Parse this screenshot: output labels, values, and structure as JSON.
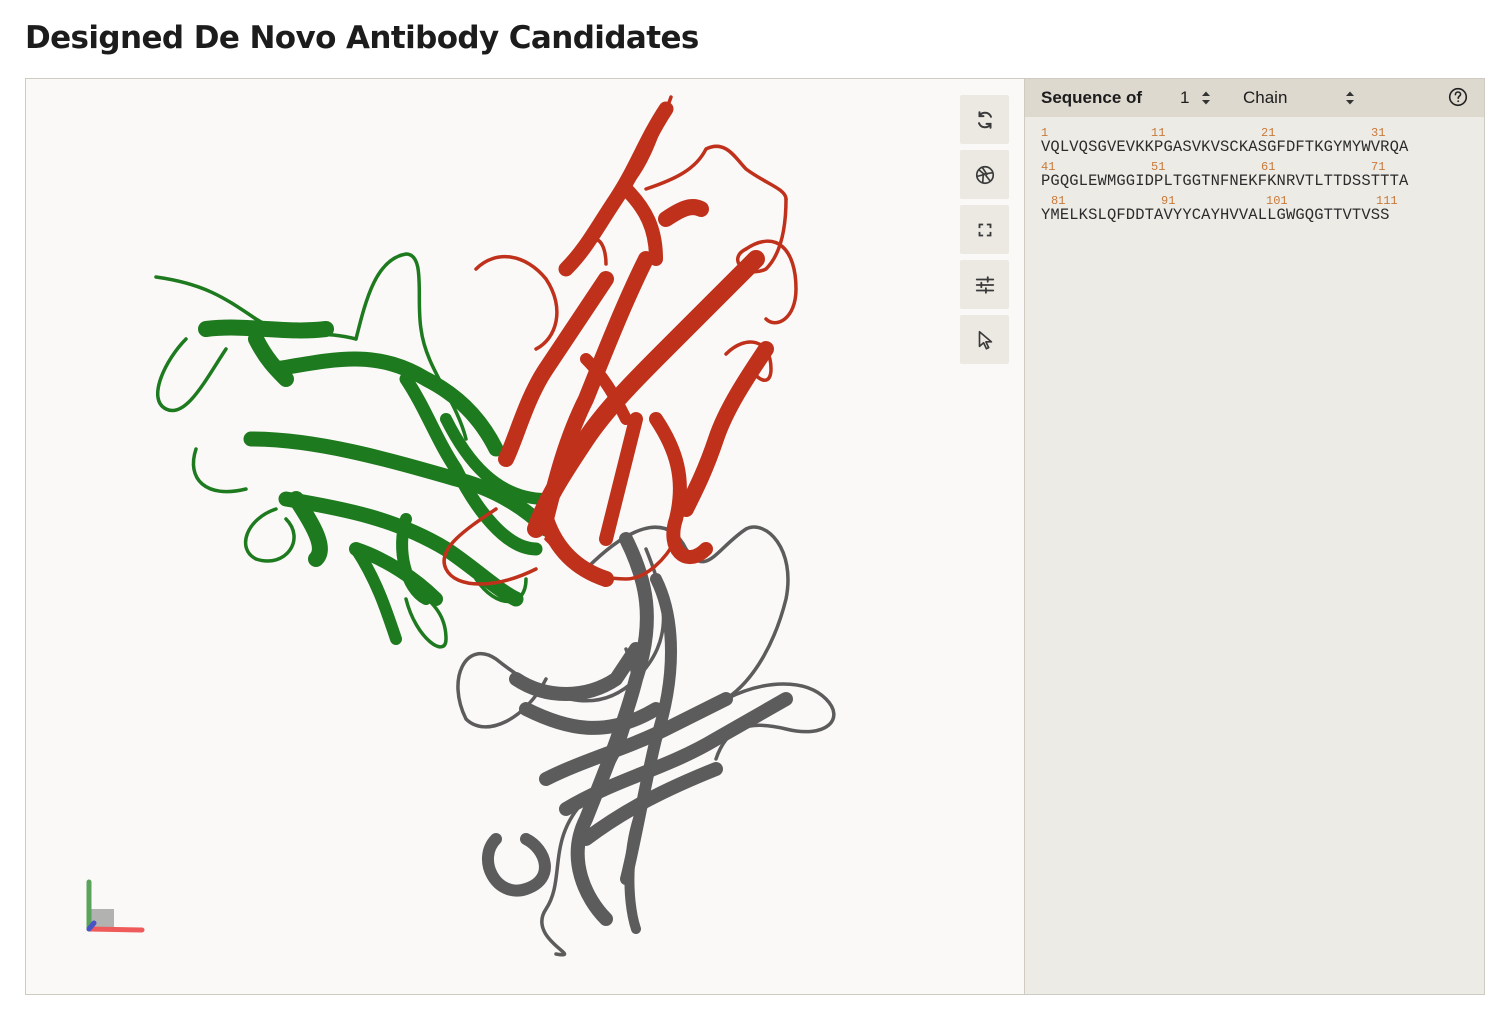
{
  "page": {
    "title": "Designed De Novo Antibody Candidates"
  },
  "viewer": {
    "chain_colors": {
      "chain_a": "#c0311c",
      "chain_b": "#1e7a1e",
      "chain_c": "#5c5c5c"
    },
    "toolbar": [
      {
        "name": "reset-view-button",
        "icon": "refresh-icon"
      },
      {
        "name": "screenshot-button",
        "icon": "camera-shutter-icon"
      },
      {
        "name": "fullscreen-button",
        "icon": "expand-icon"
      },
      {
        "name": "settings-button",
        "icon": "sliders-icon"
      },
      {
        "name": "selection-mode-button",
        "icon": "cursor-icon"
      }
    ]
  },
  "sequence_panel": {
    "title": "Sequence of",
    "model_value": "1",
    "chain_value": "Chain",
    "help_icon": "question-circle-icon",
    "rows": [
      {
        "numbers": [
          "1",
          "11",
          "21",
          "31"
        ],
        "residues": "VQLVQSGVEVKKPGASVKVSCKASGFDFTKGYMYWVRQA"
      },
      {
        "numbers": [
          "41",
          "51",
          "61",
          "71"
        ],
        "residues": "PGQGLEWMGGIDPLTGGTNFNEKFKNRVTLTTDSSTTTA"
      },
      {
        "numbers": [
          "81",
          "91",
          "101",
          "111"
        ],
        "residues": "YMELKSLQFDDTAVYYCAYHVVALLGWGQGTTVTVSS"
      }
    ]
  }
}
